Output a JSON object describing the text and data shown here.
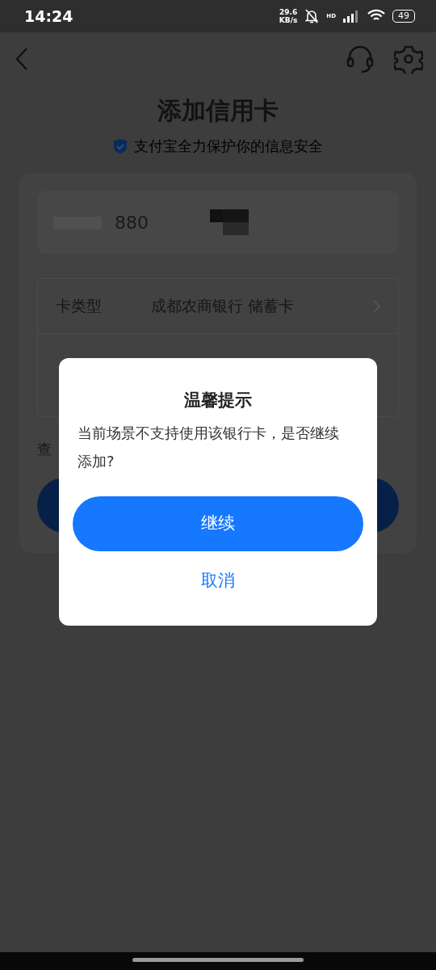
{
  "status_bar": {
    "time": "14:24",
    "net_speed_value": "29.6",
    "net_speed_unit": "KB/s",
    "signal_label": "HD",
    "battery": "49"
  },
  "page": {
    "title": "添加信用卡",
    "security_note": "支付宝全力保护你的信息安全",
    "card_number_visible": "880",
    "card_type_label": "卡类型",
    "card_type_value": "成都农商银行 储蓄卡",
    "link_text_partial": "查"
  },
  "dialog": {
    "title": "温馨提示",
    "message": "当前场景不支持使用该银行卡，是否继续添加?",
    "buttons": [
      {
        "kind": "primary",
        "label": "继续"
      },
      {
        "kind": "text",
        "label": "取消"
      }
    ]
  }
}
